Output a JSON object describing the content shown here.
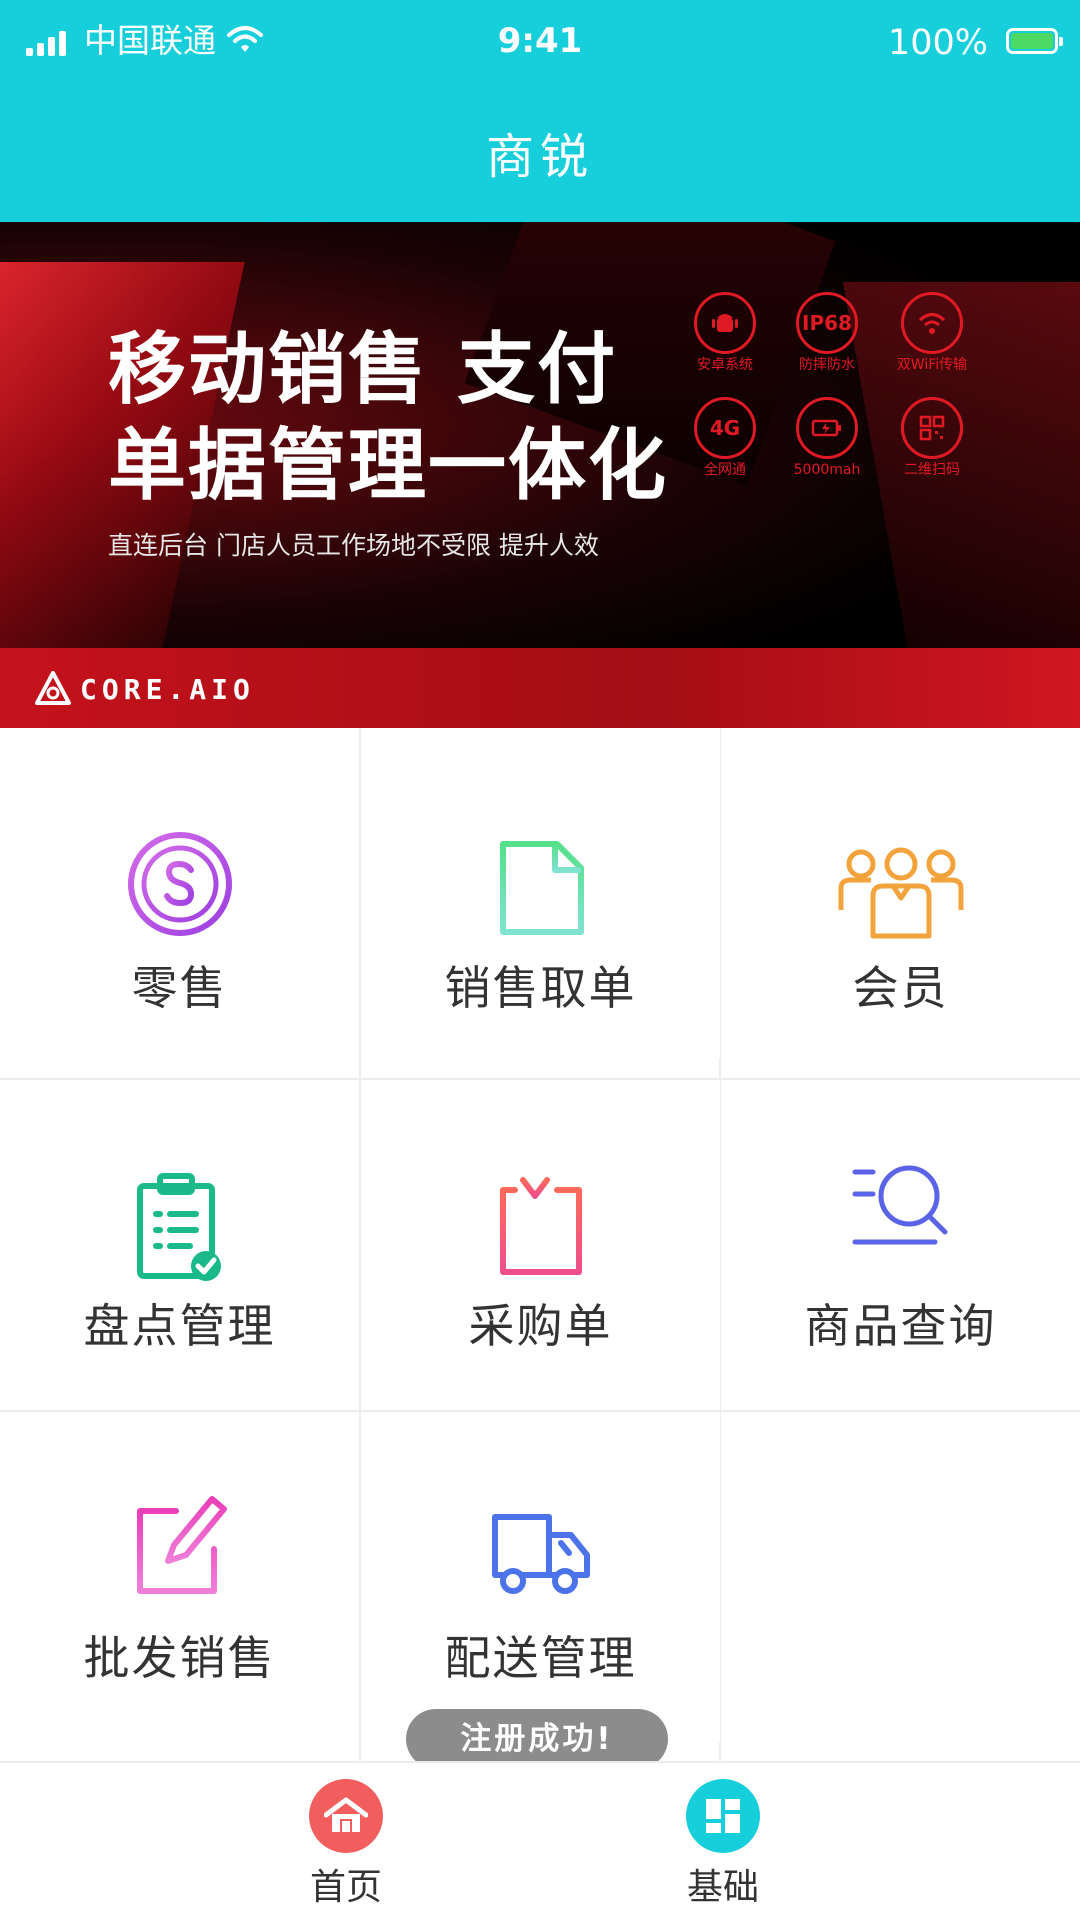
{
  "status_bar": {
    "carrier": "中国联通",
    "time": "9:41",
    "battery": "100%",
    "icons": [
      "signal-icon",
      "wifi-icon",
      "battery-icon"
    ]
  },
  "header": {
    "title": "商锐"
  },
  "banner": {
    "headline_1": "移动销售 支付",
    "headline_2": "单据管理一体化",
    "subline": "直连后台 门店人员工作场地不受限 提升人效",
    "features": [
      {
        "icon": "android-icon",
        "badge": "",
        "caption": "安卓系统"
      },
      {
        "icon": "ip68-icon",
        "badge": "IP68",
        "caption": "防摔防水"
      },
      {
        "icon": "wifi-icon",
        "badge": "",
        "caption": "双WiFi传输"
      },
      {
        "icon": "4g-icon",
        "badge": "4G",
        "caption": "全网通"
      },
      {
        "icon": "battery-icon",
        "badge": "",
        "caption": "5000mah"
      },
      {
        "icon": "qrcode-icon",
        "badge": "",
        "caption": "二维扫码"
      }
    ],
    "brand": "CORE.AIO",
    "colors": {
      "accent": "#e01a24",
      "stripe": "#c4121c"
    }
  },
  "menu": {
    "items": [
      {
        "label": "零售",
        "icon": "dollar-coin-icon",
        "color": "#b452e6"
      },
      {
        "label": "销售取单",
        "icon": "document-icon",
        "color": "#3fd3a1"
      },
      {
        "label": "会员",
        "icon": "members-icon",
        "color": "#f3a33b"
      },
      {
        "label": "盘点管理",
        "icon": "clipboard-check-icon",
        "color": "#1ab98a"
      },
      {
        "label": "采购单",
        "icon": "purchase-order-icon",
        "color": "#f0567a"
      },
      {
        "label": "商品查询",
        "icon": "search-list-icon",
        "color": "#5b63e8"
      },
      {
        "label": "批发销售",
        "icon": "edit-icon",
        "color": "#e74bc6"
      },
      {
        "label": "配送管理",
        "icon": "truck-icon",
        "color": "#4d73ea"
      }
    ]
  },
  "toast": {
    "text": "注册成功!"
  },
  "tabbar": {
    "items": [
      {
        "label": "首页",
        "icon": "home-icon",
        "color": "#f25e5e"
      },
      {
        "label": "基础",
        "icon": "dashboard-icon",
        "color": "#17cedb"
      }
    ]
  },
  "theme": {
    "primary": "#17cedb"
  }
}
